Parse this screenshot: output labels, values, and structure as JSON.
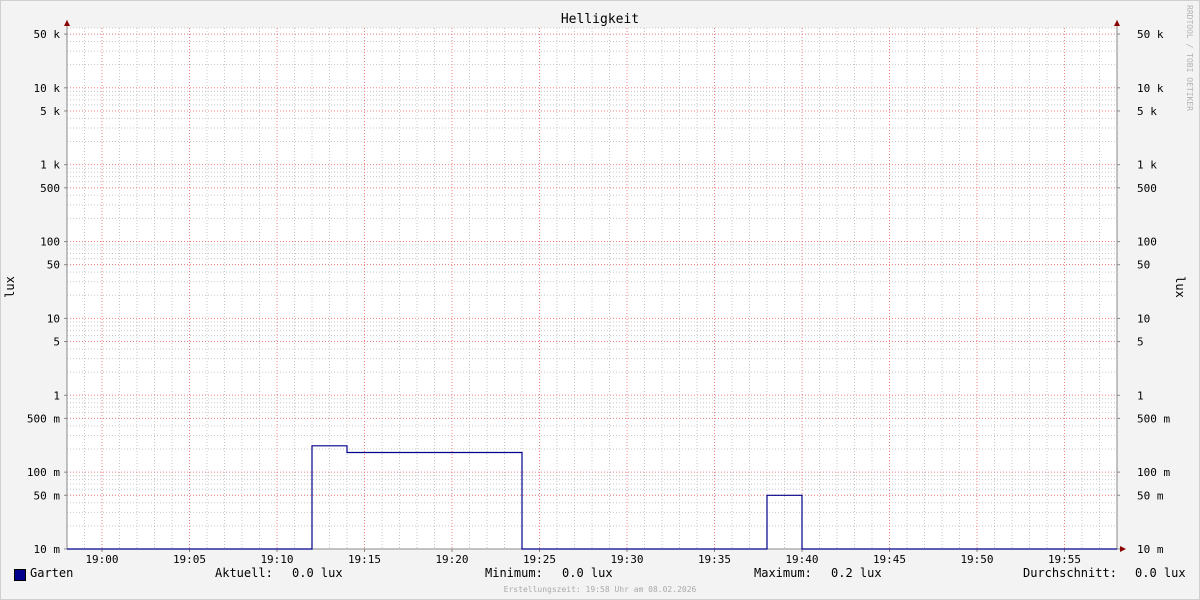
{
  "chart_data": {
    "type": "line",
    "title": "Helligkeit",
    "ylabel": "lux",
    "ylabel_right": "lux",
    "y_scale": "log",
    "ylim": [
      0.01,
      60000
    ],
    "y_ticks": [
      {
        "value": 50000,
        "label": "50 k"
      },
      {
        "value": 10000,
        "label": "10 k"
      },
      {
        "value": 5000,
        "label": "5 k"
      },
      {
        "value": 1000,
        "label": "1 k"
      },
      {
        "value": 500,
        "label": "500"
      },
      {
        "value": 100,
        "label": "100"
      },
      {
        "value": 50,
        "label": "50"
      },
      {
        "value": 10,
        "label": "10"
      },
      {
        "value": 5,
        "label": "5"
      },
      {
        "value": 1,
        "label": "1"
      },
      {
        "value": 0.5,
        "label": "500 m"
      },
      {
        "value": 0.1,
        "label": "100 m"
      },
      {
        "value": 0.05,
        "label": "50 m"
      },
      {
        "value": 0.01,
        "label": "10 m"
      }
    ],
    "xlim": [
      "18:58",
      "19:58"
    ],
    "x_ticks": [
      "19:00",
      "19:05",
      "19:10",
      "19:15",
      "19:20",
      "19:25",
      "19:30",
      "19:35",
      "19:40",
      "19:45",
      "19:50",
      "19:55"
    ],
    "grid": true,
    "series": [
      {
        "name": "Garten",
        "color": "#00008b",
        "points": [
          [
            "18:58",
            0.01
          ],
          [
            "19:12",
            0.01
          ],
          [
            "19:12",
            0.22
          ],
          [
            "19:14",
            0.22
          ],
          [
            "19:14",
            0.18
          ],
          [
            "19:24",
            0.18
          ],
          [
            "19:24",
            0.01
          ],
          [
            "19:38",
            0.01
          ],
          [
            "19:38",
            0.05
          ],
          [
            "19:40",
            0.05
          ],
          [
            "19:40",
            0.01
          ],
          [
            "19:58",
            0.01
          ]
        ]
      }
    ]
  },
  "legend": {
    "series_name": "Garten",
    "current_label": "Aktuell:",
    "current_value": "0.0 lux",
    "min_label": "Minimum:",
    "min_value": "0.0 lux",
    "max_label": "Maximum:",
    "max_value": "0.2 lux",
    "avg_label": "Durchschnitt:",
    "avg_value": "0.0 lux"
  },
  "watermark": "RRDTOOL / TOBI OETIKER",
  "footer": "Erstellungszeit: 19:58 Uhr am 08.02.2026",
  "colors": {
    "background": "#f3f3f3",
    "canvas": "#ffffff",
    "major_grid": "#f08080",
    "minor_grid": "#c8c8c8",
    "axis_arrow": "#8b0000",
    "line": "#00008b"
  }
}
